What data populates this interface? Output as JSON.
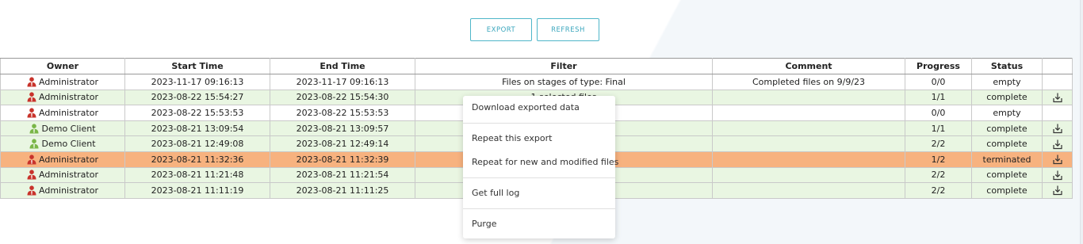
{
  "toolbar": {
    "export_label": "EXPORT",
    "refresh_label": "REFRESH"
  },
  "table": {
    "headers": {
      "owner": "Owner",
      "start_time": "Start Time",
      "end_time": "End Time",
      "filter": "Filter",
      "comment": "Comment",
      "progress": "Progress",
      "status": "Status"
    },
    "rows": [
      {
        "owner": "Administrator",
        "role": "admin",
        "start": "2023-11-17 09:16:13",
        "end": "2023-11-17 09:16:13",
        "filter": "Files on stages of type: Final",
        "comment": "Completed files on 9/9/23",
        "progress": "0/0",
        "status": "empty",
        "download": false,
        "highlight": "white"
      },
      {
        "owner": "Administrator",
        "role": "admin",
        "start": "2023-08-22 15:54:27",
        "end": "2023-08-22 15:54:30",
        "filter": "1 selected files",
        "comment": "",
        "progress": "1/1",
        "status": "complete",
        "download": true,
        "highlight": "green"
      },
      {
        "owner": "Administrator",
        "role": "admin",
        "start": "2023-08-22 15:53:53",
        "end": "2023-08-22 15:53:53",
        "filter": "11:11:19",
        "comment": "",
        "progress": "0/0",
        "status": "empty",
        "download": false,
        "highlight": "white"
      },
      {
        "owner": "Demo Client",
        "role": "client",
        "start": "2023-08-21 13:09:54",
        "end": "2023-08-21 13:09:57",
        "filter": "",
        "comment": "",
        "progress": "1/1",
        "status": "complete",
        "download": true,
        "highlight": "green"
      },
      {
        "owner": "Demo Client",
        "role": "client",
        "start": "2023-08-21 12:49:08",
        "end": "2023-08-21 12:49:14",
        "filter": "",
        "comment": "",
        "progress": "2/2",
        "status": "complete",
        "download": true,
        "highlight": "green"
      },
      {
        "owner": "Administrator",
        "role": "admin",
        "start": "2023-08-21 11:32:36",
        "end": "2023-08-21 11:32:39",
        "filter": "",
        "comment": "",
        "progress": "1/2",
        "status": "terminated",
        "download": true,
        "highlight": "orange"
      },
      {
        "owner": "Administrator",
        "role": "admin",
        "start": "2023-08-21 11:21:48",
        "end": "2023-08-21 11:21:54",
        "filter": "",
        "comment": "",
        "progress": "2/2",
        "status": "complete",
        "download": true,
        "highlight": "green"
      },
      {
        "owner": "Administrator",
        "role": "admin",
        "start": "2023-08-21 11:11:19",
        "end": "2023-08-21 11:11:25",
        "filter": "",
        "comment": "",
        "progress": "2/2",
        "status": "complete",
        "download": true,
        "highlight": "green"
      }
    ]
  },
  "context_menu": {
    "groups": [
      [
        "Download exported data"
      ],
      [
        "Repeat this export",
        "Repeat for new and modified files"
      ],
      [
        "Get full log"
      ],
      [
        "Purge"
      ]
    ]
  },
  "colors": {
    "accent": "#3aa6bd",
    "admin_icon": "#c8332b",
    "client_icon": "#7ab648",
    "row_green": "#e9f6e2",
    "row_orange": "#f7b27f"
  },
  "icons": {
    "admin": "user-admin-icon",
    "client": "user-client-icon",
    "download": "download-icon"
  }
}
